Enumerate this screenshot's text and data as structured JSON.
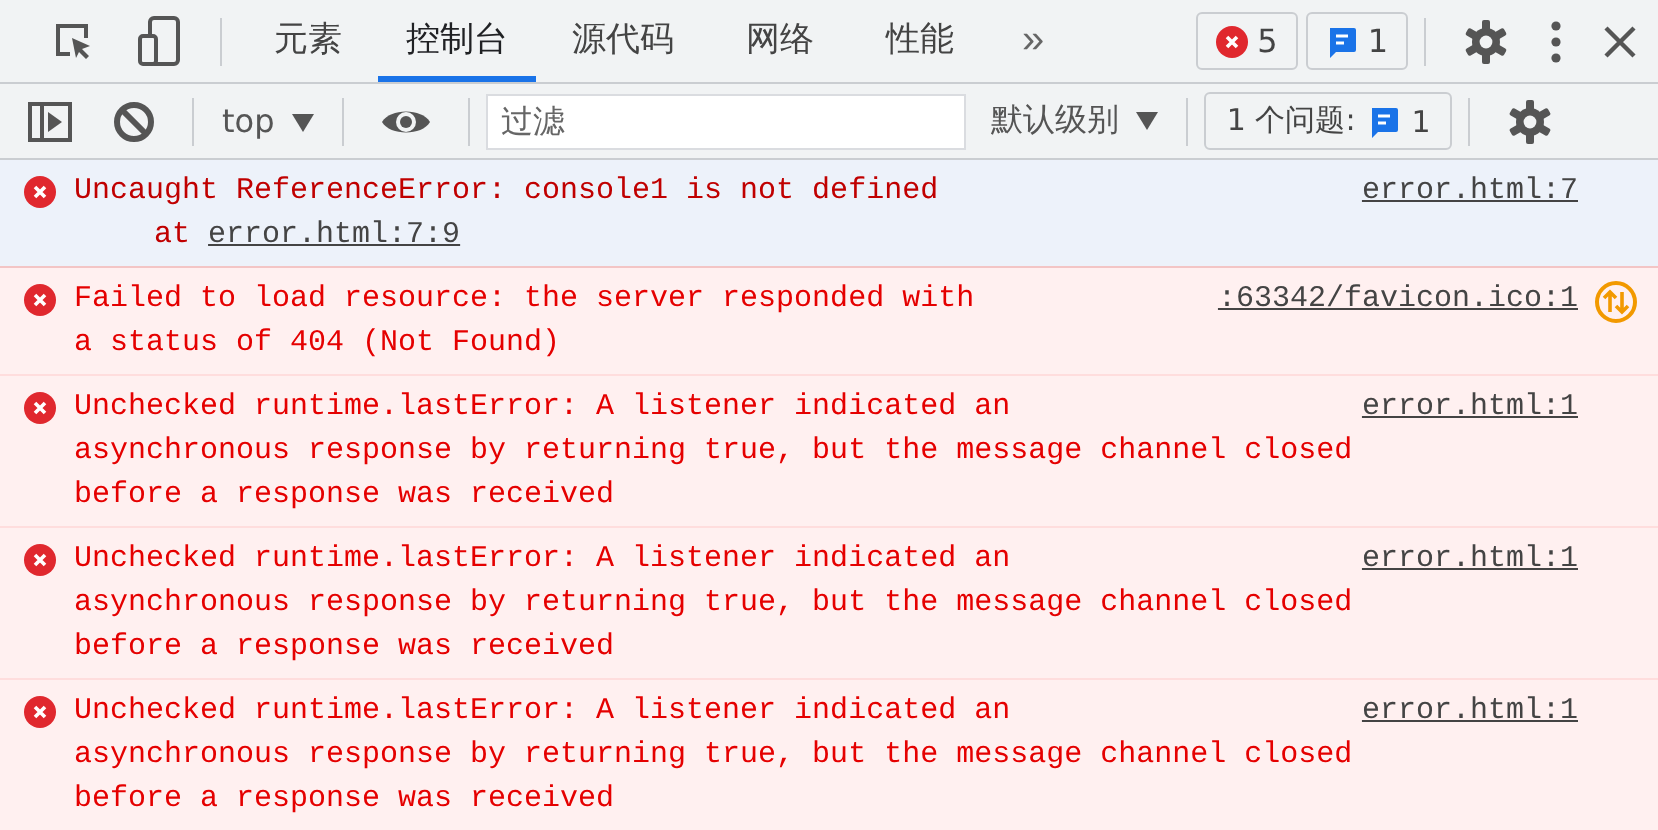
{
  "tabs": [
    {
      "label": "元素",
      "selected": false
    },
    {
      "label": "控制台",
      "selected": true
    },
    {
      "label": "源代码",
      "selected": false
    },
    {
      "label": "网络",
      "selected": false
    },
    {
      "label": "性能",
      "selected": false
    }
  ],
  "more_tabs": "»",
  "error_count": "5",
  "message_count": "1",
  "context": "top",
  "filter": {
    "placeholder": "过滤"
  },
  "levels": "默认级别",
  "issues": {
    "label": "1 个问题:",
    "count": "1"
  },
  "messages": [
    {
      "lines": [
        "Uncaught ReferenceError: console1 is not defined"
      ],
      "stack": {
        "prefix": "at",
        "link": "error.html:7:9"
      },
      "source": "error.html:7",
      "selected": true,
      "network": false
    },
    {
      "lines": [
        "Failed to load resource: the server responded with",
        "a status of 404 (Not Found)"
      ],
      "source": ":63342/favicon.ico:1",
      "selected": false,
      "network": true
    },
    {
      "lines": [
        "Unchecked runtime.lastError: A listener indicated an",
        "asynchronous response by returning true, but the message channel closed",
        "before a response was received"
      ],
      "source": "error.html:1",
      "selected": false,
      "network": false
    },
    {
      "lines": [
        "Unchecked runtime.lastError: A listener indicated an",
        "asynchronous response by returning true, but the message channel closed",
        "before a response was received"
      ],
      "source": "error.html:1",
      "selected": false,
      "network": false
    },
    {
      "lines": [
        "Unchecked runtime.lastError: A listener indicated an",
        "asynchronous response by returning true, but the message channel closed",
        "before a response was received"
      ],
      "source": "error.html:1",
      "selected": false,
      "network": false
    }
  ]
}
